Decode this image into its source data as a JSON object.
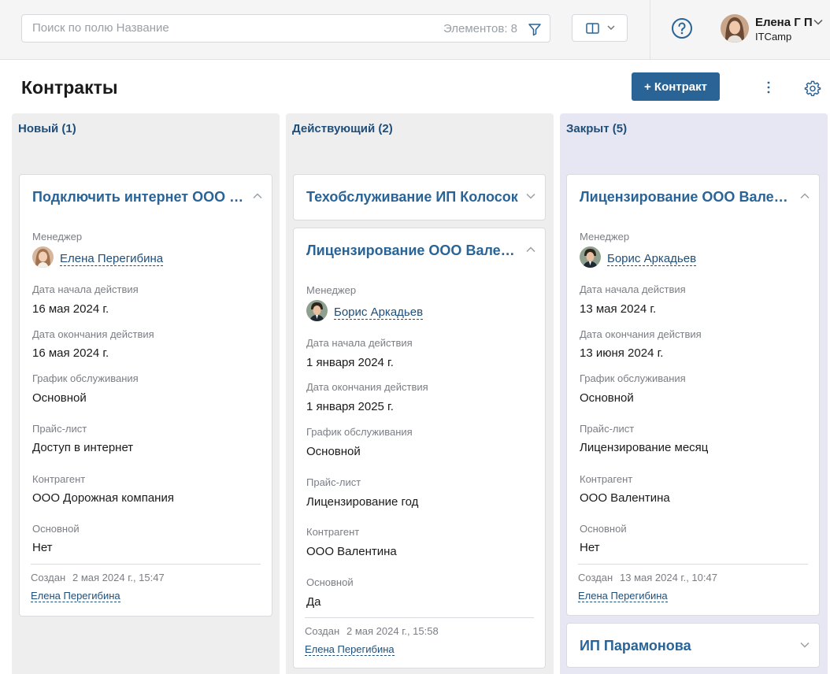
{
  "search": {
    "placeholder": "Поиск по полю Название",
    "count_text": "Элементов: 8"
  },
  "user": {
    "name": "Елена Г П",
    "company": "ITCamp"
  },
  "header": {
    "title": "Контракты",
    "add_button": "+ Контракт"
  },
  "labels": {
    "manager": "Менеджер",
    "start_date": "Дата начала действия",
    "end_date": "Дата окончания действия",
    "schedule": "График обслуживания",
    "price_list": "Прайс-лист",
    "counterparty": "Контрагент",
    "primary": "Основной",
    "created": "Создан"
  },
  "columns": [
    {
      "title": "Новый (1)",
      "cards": [
        {
          "title": "Подключить интернет ООО Дорожная компания",
          "manager": "Елена Перегибина",
          "start_date": "16 мая 2024 г.",
          "end_date": "16 мая 2024 г.",
          "schedule": "Основной",
          "price_list": "Доступ в интернет",
          "counterparty": "ООО Дорожная компания",
          "primary": "Нет",
          "created_date": "2 мая 2024 г., 15:47",
          "creator": "Елена Перегибина"
        }
      ]
    },
    {
      "title": "Действующий (2)",
      "cards": [
        {
          "title": "Техобслуживание ИП Колосок"
        },
        {
          "title": "Лицензирование ООО Валентина",
          "manager": "Борис Аркадьев",
          "start_date": "1 января 2024 г.",
          "end_date": "1 января 2025 г.",
          "schedule": "Основной",
          "price_list": "Лицензирование год",
          "counterparty": "ООО Валентина",
          "primary": "Да",
          "created_date": "2 мая 2024 г., 15:58",
          "creator": "Елена Перегибина"
        }
      ]
    },
    {
      "title": "Закрыт (5)",
      "cards": [
        {
          "title": "Лицензирование ООО Валентина",
          "manager": "Борис Аркадьев",
          "start_date": "13 мая 2024 г.",
          "end_date": "13 июня 2024 г.",
          "schedule": "Основной",
          "price_list": "Лицензирование месяц",
          "counterparty": "ООО Валентина",
          "primary": "Нет",
          "created_date": "13 мая 2024 г., 10:47",
          "creator": "Елена Перегибина"
        },
        {
          "title": "ИП Парамонова"
        }
      ]
    }
  ]
}
